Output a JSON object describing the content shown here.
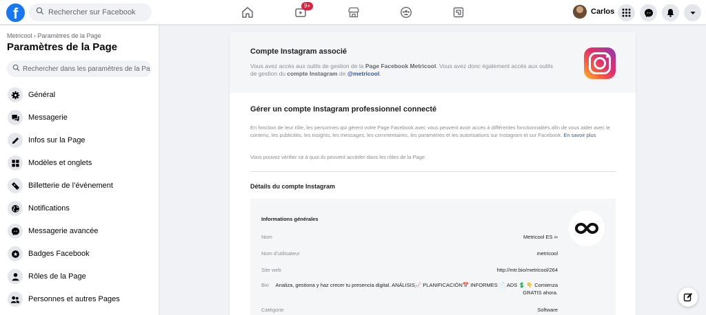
{
  "topbar": {
    "logo_letter": "f",
    "search_placeholder": "Rechercher sur Facebook",
    "notification_count": "9+",
    "user_name": "Carlos"
  },
  "sidebar": {
    "breadcrumb": "Metricool › Paramètres de la Page",
    "title": "Paramètres de la Page",
    "search_placeholder": "Rechercher dans les paramètres de la Page",
    "items": [
      {
        "label": "Général",
        "icon": "gear-icon"
      },
      {
        "label": "Messagerie",
        "icon": "chat-icon"
      },
      {
        "label": "Infos sur la Page",
        "icon": "pencil-icon"
      },
      {
        "label": "Modèles et onglets",
        "icon": "grid-icon"
      },
      {
        "label": "Billetterie de l’évènement",
        "icon": "ticket-icon"
      },
      {
        "label": "Notifications",
        "icon": "globe-icon"
      },
      {
        "label": "Messagerie avancée",
        "icon": "messenger-icon"
      },
      {
        "label": "Badges Facebook",
        "icon": "badge-icon"
      },
      {
        "label": "Rôles de la Page",
        "icon": "person-icon"
      },
      {
        "label": "Personnes et autres Pages",
        "icon": "people-icon"
      }
    ]
  },
  "main": {
    "heading": "Compte Instagram associé",
    "intro": {
      "part1": "Vous avez accès aux outils de gestion de la ",
      "page_name": "Page Facebook Metricool",
      "part2": ". Vous avez donc également accès aux outils de gestion du ",
      "account_label": "compte Instagram",
      "part3": " de ",
      "handle": "@metricool",
      "part4": "."
    },
    "section_title": "Gérer un compte Instagram professionnel connecté",
    "section_text": "En fonction de leur rôle, les personnes qui gèrent votre Page Facebook avec vous peuvent avoir accès à différentes fonctionnalités afin de vous aider avec le contenu, les publicités, les insights, les messages, les commentaires, les paramètres et les autorisations sur Instagram et sur Facebook. ",
    "learn_more": "En savoir plus",
    "roles_text": "Vous pouvez vérifier ce à quoi ils peuvent accéder dans les rôles de la Page.",
    "details_title": "Détails du compte Instagram",
    "panel": {
      "title": "Informations générales",
      "rows": [
        {
          "label": "Nom",
          "value": "Metricool ES ∞"
        },
        {
          "label": "Nom d’utilisateur",
          "value": "metricool"
        },
        {
          "label": "Site web",
          "value": "http://mtr.bio/metricool/264"
        },
        {
          "label": "Bio",
          "value": "Analiza, gestiona y haz crecer tu presencia digital. ANÁLISIS📈 PLANIFICACIÓN📅 INFORMES 📄 ADS 💲 👇 Comienza GRATIS ahora."
        },
        {
          "label": "Catégorie",
          "value": "Software"
        }
      ]
    }
  }
}
